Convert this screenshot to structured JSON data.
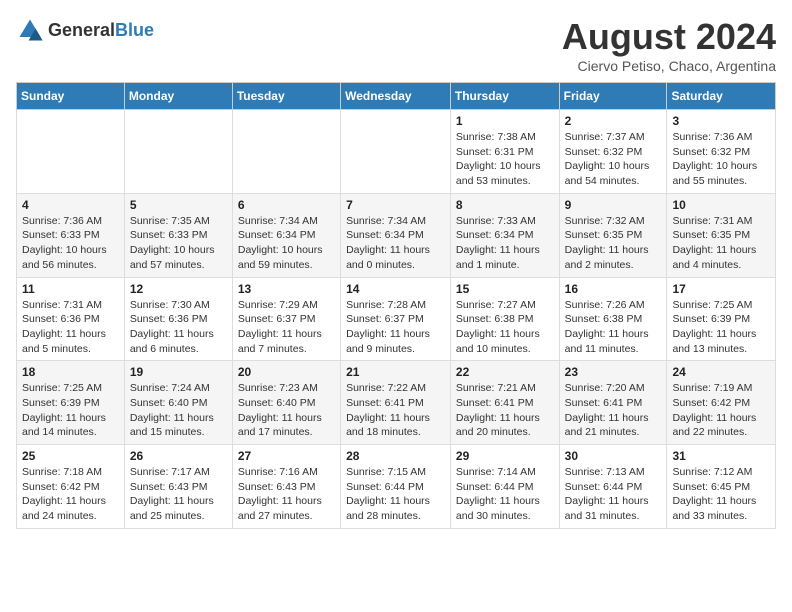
{
  "header": {
    "logo_general": "General",
    "logo_blue": "Blue",
    "month_year": "August 2024",
    "location": "Ciervo Petiso, Chaco, Argentina"
  },
  "weekdays": [
    "Sunday",
    "Monday",
    "Tuesday",
    "Wednesday",
    "Thursday",
    "Friday",
    "Saturday"
  ],
  "weeks": [
    [
      {
        "day": "",
        "info": ""
      },
      {
        "day": "",
        "info": ""
      },
      {
        "day": "",
        "info": ""
      },
      {
        "day": "",
        "info": ""
      },
      {
        "day": "1",
        "info": "Sunrise: 7:38 AM\nSunset: 6:31 PM\nDaylight: 10 hours and 53 minutes."
      },
      {
        "day": "2",
        "info": "Sunrise: 7:37 AM\nSunset: 6:32 PM\nDaylight: 10 hours and 54 minutes."
      },
      {
        "day": "3",
        "info": "Sunrise: 7:36 AM\nSunset: 6:32 PM\nDaylight: 10 hours and 55 minutes."
      }
    ],
    [
      {
        "day": "4",
        "info": "Sunrise: 7:36 AM\nSunset: 6:33 PM\nDaylight: 10 hours and 56 minutes."
      },
      {
        "day": "5",
        "info": "Sunrise: 7:35 AM\nSunset: 6:33 PM\nDaylight: 10 hours and 57 minutes."
      },
      {
        "day": "6",
        "info": "Sunrise: 7:34 AM\nSunset: 6:34 PM\nDaylight: 10 hours and 59 minutes."
      },
      {
        "day": "7",
        "info": "Sunrise: 7:34 AM\nSunset: 6:34 PM\nDaylight: 11 hours and 0 minutes."
      },
      {
        "day": "8",
        "info": "Sunrise: 7:33 AM\nSunset: 6:34 PM\nDaylight: 11 hours and 1 minute."
      },
      {
        "day": "9",
        "info": "Sunrise: 7:32 AM\nSunset: 6:35 PM\nDaylight: 11 hours and 2 minutes."
      },
      {
        "day": "10",
        "info": "Sunrise: 7:31 AM\nSunset: 6:35 PM\nDaylight: 11 hours and 4 minutes."
      }
    ],
    [
      {
        "day": "11",
        "info": "Sunrise: 7:31 AM\nSunset: 6:36 PM\nDaylight: 11 hours and 5 minutes."
      },
      {
        "day": "12",
        "info": "Sunrise: 7:30 AM\nSunset: 6:36 PM\nDaylight: 11 hours and 6 minutes."
      },
      {
        "day": "13",
        "info": "Sunrise: 7:29 AM\nSunset: 6:37 PM\nDaylight: 11 hours and 7 minutes."
      },
      {
        "day": "14",
        "info": "Sunrise: 7:28 AM\nSunset: 6:37 PM\nDaylight: 11 hours and 9 minutes."
      },
      {
        "day": "15",
        "info": "Sunrise: 7:27 AM\nSunset: 6:38 PM\nDaylight: 11 hours and 10 minutes."
      },
      {
        "day": "16",
        "info": "Sunrise: 7:26 AM\nSunset: 6:38 PM\nDaylight: 11 hours and 11 minutes."
      },
      {
        "day": "17",
        "info": "Sunrise: 7:25 AM\nSunset: 6:39 PM\nDaylight: 11 hours and 13 minutes."
      }
    ],
    [
      {
        "day": "18",
        "info": "Sunrise: 7:25 AM\nSunset: 6:39 PM\nDaylight: 11 hours and 14 minutes."
      },
      {
        "day": "19",
        "info": "Sunrise: 7:24 AM\nSunset: 6:40 PM\nDaylight: 11 hours and 15 minutes."
      },
      {
        "day": "20",
        "info": "Sunrise: 7:23 AM\nSunset: 6:40 PM\nDaylight: 11 hours and 17 minutes."
      },
      {
        "day": "21",
        "info": "Sunrise: 7:22 AM\nSunset: 6:41 PM\nDaylight: 11 hours and 18 minutes."
      },
      {
        "day": "22",
        "info": "Sunrise: 7:21 AM\nSunset: 6:41 PM\nDaylight: 11 hours and 20 minutes."
      },
      {
        "day": "23",
        "info": "Sunrise: 7:20 AM\nSunset: 6:41 PM\nDaylight: 11 hours and 21 minutes."
      },
      {
        "day": "24",
        "info": "Sunrise: 7:19 AM\nSunset: 6:42 PM\nDaylight: 11 hours and 22 minutes."
      }
    ],
    [
      {
        "day": "25",
        "info": "Sunrise: 7:18 AM\nSunset: 6:42 PM\nDaylight: 11 hours and 24 minutes."
      },
      {
        "day": "26",
        "info": "Sunrise: 7:17 AM\nSunset: 6:43 PM\nDaylight: 11 hours and 25 minutes."
      },
      {
        "day": "27",
        "info": "Sunrise: 7:16 AM\nSunset: 6:43 PM\nDaylight: 11 hours and 27 minutes."
      },
      {
        "day": "28",
        "info": "Sunrise: 7:15 AM\nSunset: 6:44 PM\nDaylight: 11 hours and 28 minutes."
      },
      {
        "day": "29",
        "info": "Sunrise: 7:14 AM\nSunset: 6:44 PM\nDaylight: 11 hours and 30 minutes."
      },
      {
        "day": "30",
        "info": "Sunrise: 7:13 AM\nSunset: 6:44 PM\nDaylight: 11 hours and 31 minutes."
      },
      {
        "day": "31",
        "info": "Sunrise: 7:12 AM\nSunset: 6:45 PM\nDaylight: 11 hours and 33 minutes."
      }
    ]
  ]
}
